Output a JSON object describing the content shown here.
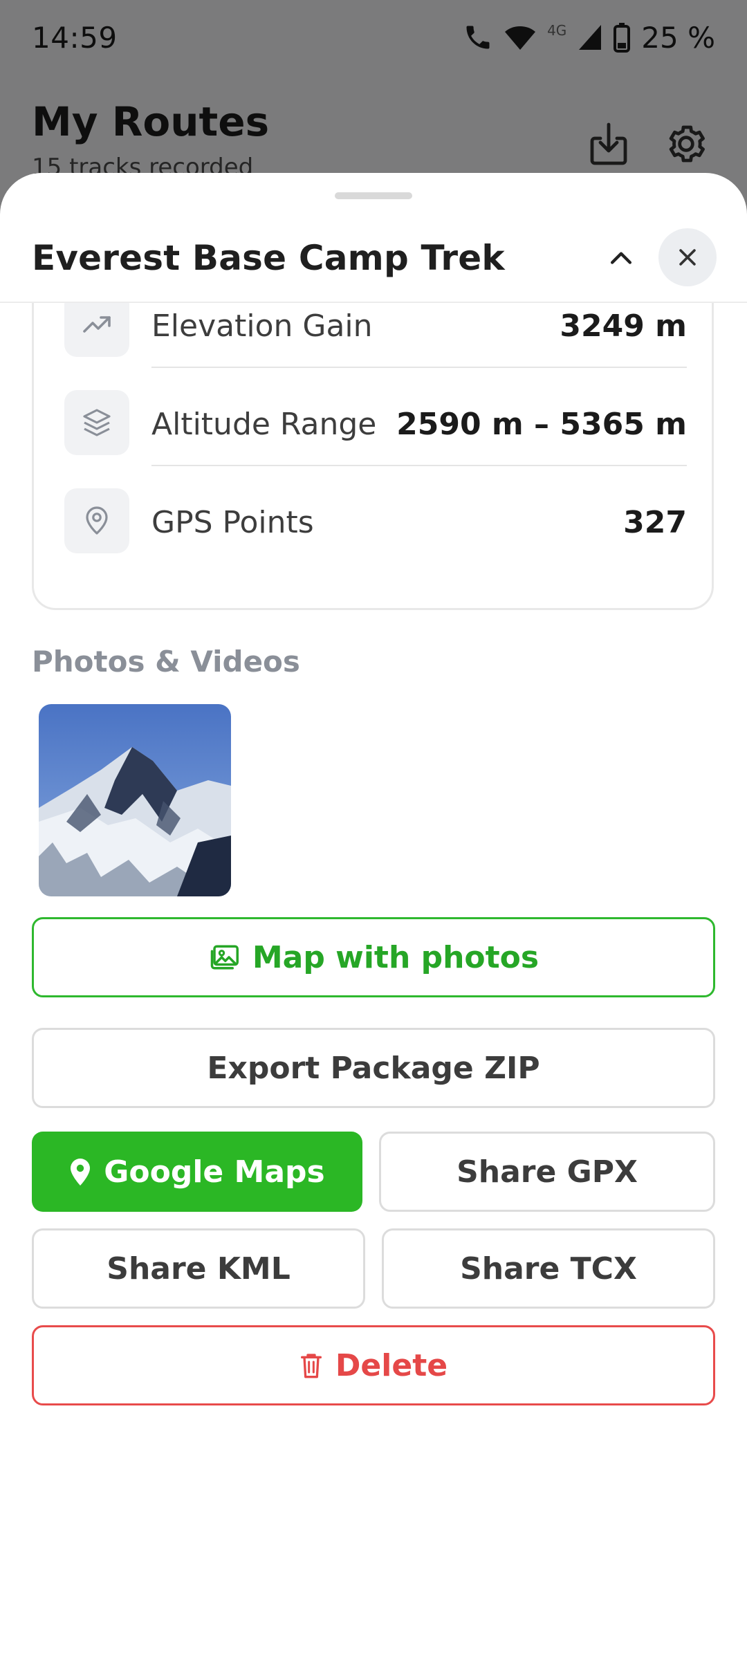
{
  "status_bar": {
    "time": "14:59",
    "network": "4G",
    "battery": "25 %"
  },
  "app": {
    "title": "My Routes",
    "subtitle": "15 tracks recorded",
    "icons": [
      "download-icon",
      "settings-icon"
    ]
  },
  "sheet": {
    "title": "Everest Base Camp Trek",
    "stats": [
      {
        "icon": "trending-up-icon",
        "label": "Elevation Gain",
        "value": "3249 m"
      },
      {
        "icon": "layers-icon",
        "label": "Altitude Range",
        "value": "2590 m – 5365 m"
      },
      {
        "icon": "location-pin-icon",
        "label": "GPS Points",
        "value": "327"
      }
    ],
    "photos_label": "Photos & Videos",
    "buttons": {
      "map_with_photos": "Map with photos",
      "export_zip": "Export Package ZIP",
      "google_maps": "Google Maps",
      "share_gpx": "Share GPX",
      "share_kml": "Share KML",
      "share_tcx": "Share TCX",
      "delete": "Delete"
    }
  },
  "colors": {
    "accent_green": "#2bb725",
    "danger_red": "#e54848",
    "muted_gray": "#8a8f98"
  }
}
